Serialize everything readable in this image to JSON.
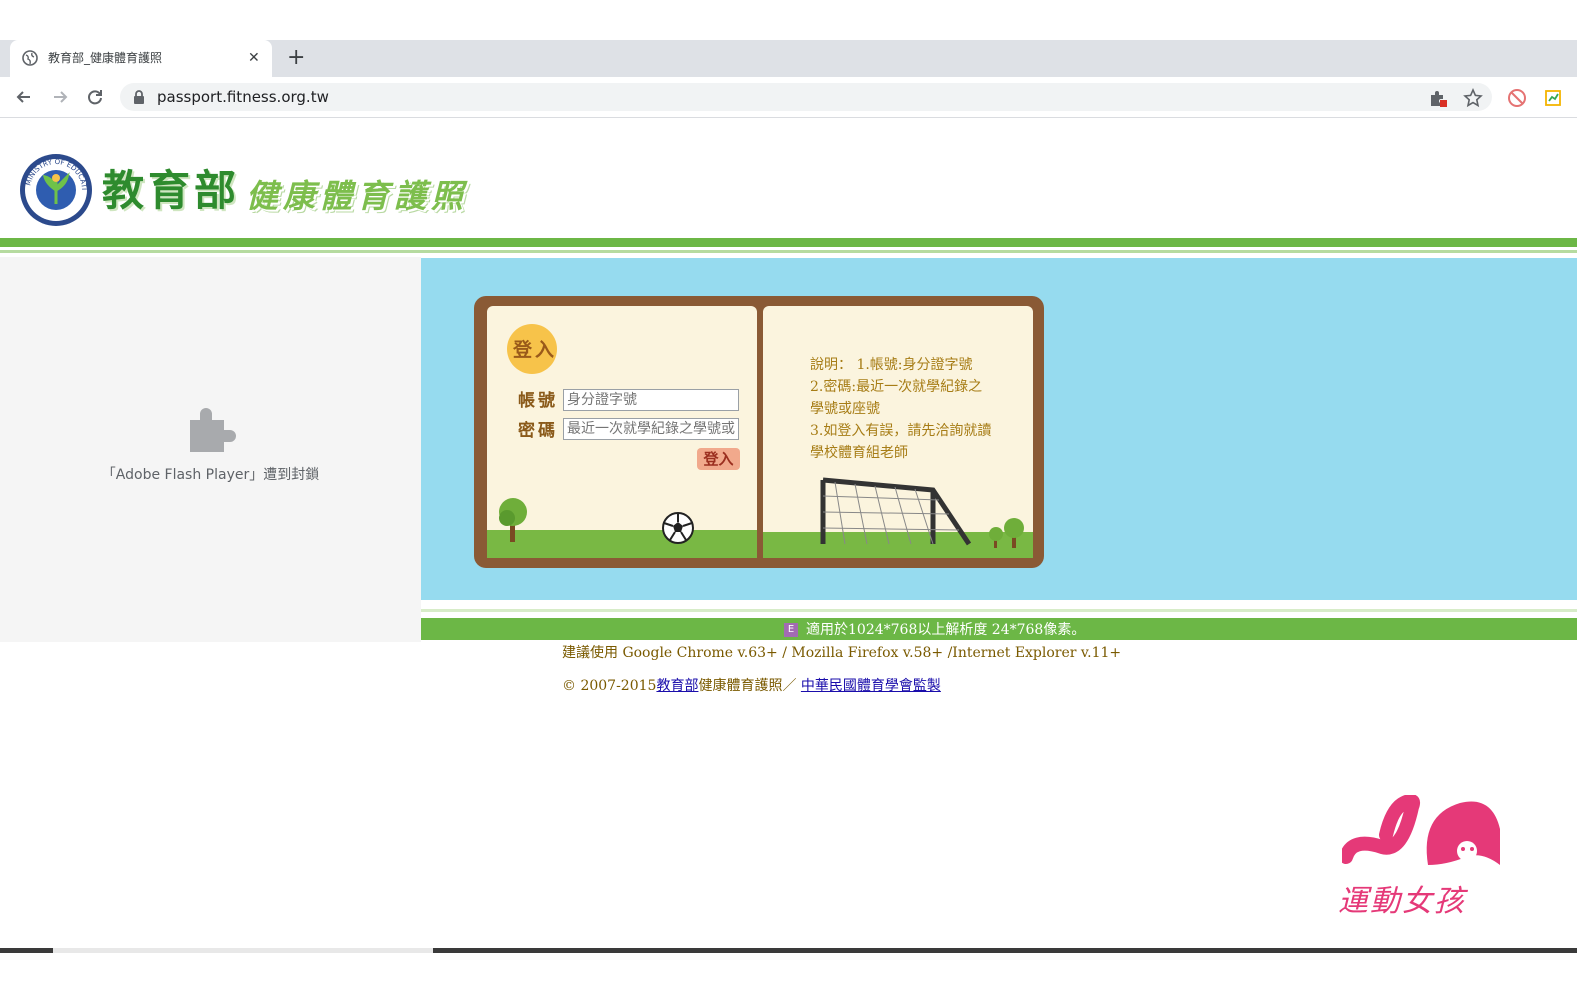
{
  "browser": {
    "tab_title": "教育部_健康體育護照",
    "url": "passport.fitness.org.tw",
    "new_tab_label": "+",
    "close_label": "✕"
  },
  "header": {
    "title": "教育部",
    "subtitle": "健康體育護照",
    "seal_text": "MINISTRY OF EDUCATION",
    "seal_center": "教育部"
  },
  "plugin": {
    "blocked_message": "「Adobe Flash Player」遭到封鎖"
  },
  "login": {
    "badge_label": "登入",
    "account_label": "帳號",
    "account_placeholder": "身分證字號",
    "password_label": "密碼",
    "password_placeholder": "最近一次就學紀錄之學號或座號",
    "submit_label": "登入",
    "notes": [
      "說明： 1.帳號:身分證字號",
      "2.密碼:最近一次就學紀錄之",
      "學號或座號",
      "3.如登入有誤，請先洽詢就讀",
      "學校體育組老師"
    ]
  },
  "footer": {
    "resolution_badge": "E",
    "resolution_note": "適用於1024*768以上解析度  24*768像素。",
    "browser_note": "建議使用 Google Chrome v.63+ / Mozilla Firefox v.58+ /Internet Explorer v.11+",
    "copyright_prefix": "© 2007-2015",
    "copyright_link1": "教育部",
    "copyright_middle": "健康體育護照／ ",
    "copyright_link2": "中華民國體育學會監製"
  },
  "watermark": {
    "text": "運動女孩"
  },
  "colors": {
    "brand_green": "#6cb746",
    "sky": "#96dbef",
    "note_text": "#a77d16",
    "watermark": "#e53978"
  },
  "icons": [
    "globe-icon",
    "close-icon",
    "back-arrow-icon",
    "forward-arrow-icon",
    "reload-icon",
    "lock-icon",
    "extension-icon",
    "star-icon",
    "blocked-icon",
    "screenshot-icon",
    "puzzle-icon",
    "soccer-ball-icon",
    "soccer-goal-icon",
    "tree-icon"
  ]
}
